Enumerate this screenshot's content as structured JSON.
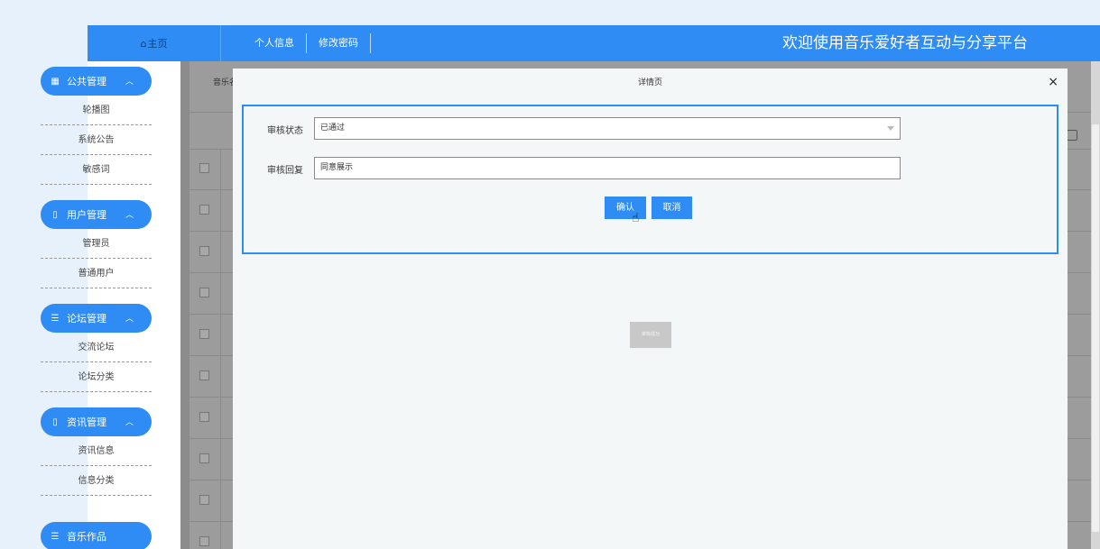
{
  "header": {
    "home_label": "主页",
    "nav": [
      "个人信息",
      "修改密码"
    ],
    "welcome": "欢迎使用音乐爱好者互动与分享平台"
  },
  "sidebar": {
    "groups": [
      {
        "label": "公共管理",
        "icon": "grid-icon",
        "items": [
          "轮播图",
          "系统公告",
          "敏感词"
        ]
      },
      {
        "label": "用户管理",
        "icon": "book-icon",
        "items": [
          "管理员",
          "普通用户"
        ]
      },
      {
        "label": "论坛管理",
        "icon": "list-icon",
        "items": [
          "交流论坛",
          "论坛分类"
        ]
      },
      {
        "label": "资讯管理",
        "icon": "book-icon",
        "items": [
          "资讯信息",
          "信息分类"
        ]
      },
      {
        "label": "音乐作品",
        "icon": "list-icon",
        "items": []
      }
    ]
  },
  "background": {
    "search_label": "音乐名"
  },
  "modal": {
    "title": "详情页",
    "close": "×",
    "status_label": "审核状态",
    "status_value": "已通过",
    "reply_label": "审核回复",
    "reply_value": "同意展示",
    "confirm": "确认",
    "cancel": "取消",
    "toast": "审核成功"
  }
}
